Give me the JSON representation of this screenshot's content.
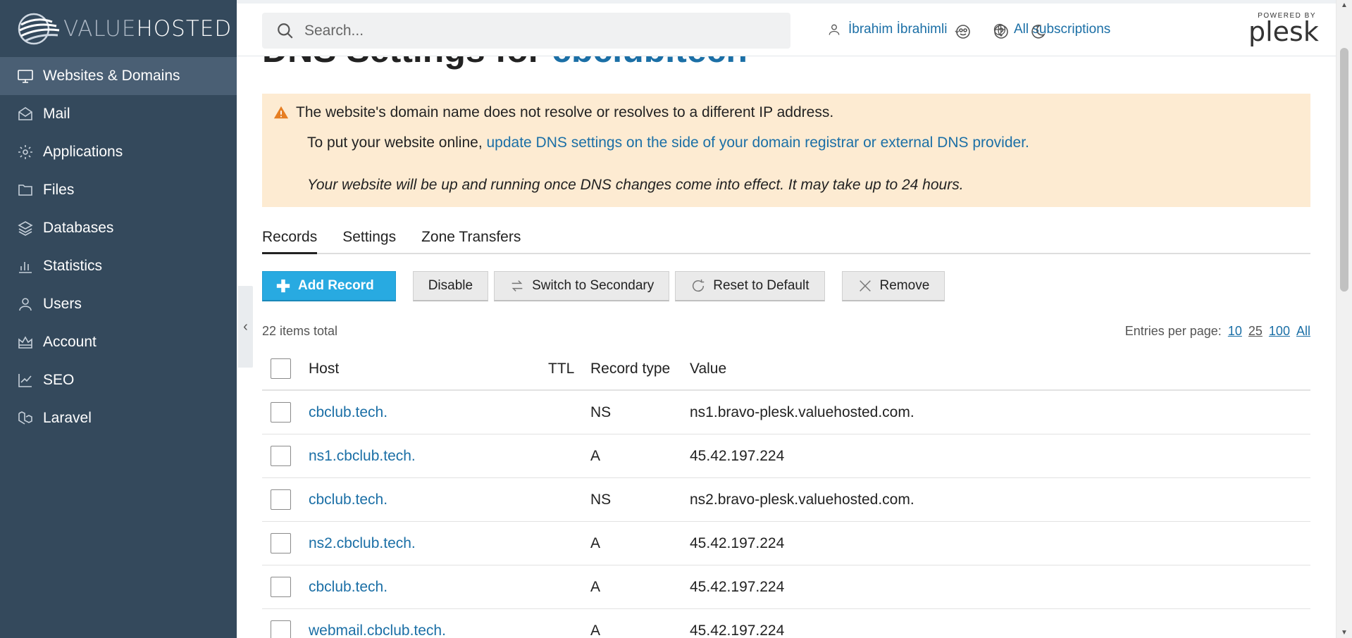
{
  "brand": {
    "logo_left": "VALUE",
    "logo_right": "HOSTED"
  },
  "sidebar": {
    "items": [
      {
        "label": "Websites & Domains",
        "icon": "monitor-icon",
        "active": true
      },
      {
        "label": "Mail",
        "icon": "envelope-icon"
      },
      {
        "label": "Applications",
        "icon": "gear-icon"
      },
      {
        "label": "Files",
        "icon": "folder-icon"
      },
      {
        "label": "Databases",
        "icon": "layers-icon"
      },
      {
        "label": "Statistics",
        "icon": "bar-chart-icon"
      },
      {
        "label": "Users",
        "icon": "user-icon"
      },
      {
        "label": "Account",
        "icon": "crown-icon"
      },
      {
        "label": "SEO",
        "icon": "trend-chart-icon"
      },
      {
        "label": "Laravel",
        "icon": "laravel-icon"
      }
    ]
  },
  "topbar": {
    "search_placeholder": "Search...",
    "user_name": "İbrahim İbrahimli",
    "subscriptions": "All subscriptions",
    "powered_by": "POWERED BY",
    "plesk": "plesk"
  },
  "page": {
    "title_prefix": "DNS Settings for ",
    "domain": "cbclub.tech"
  },
  "alert": {
    "line1": "The website's domain name does not resolve or resolves to a different IP address.",
    "line2_prefix": "To put your website online, ",
    "line2_link": "update DNS settings on the side of your domain registrar or external DNS provider.",
    "line3": "Your website will be up and running once DNS changes come into effect. It may take up to 24 hours."
  },
  "tabs": [
    "Records",
    "Settings",
    "Zone Transfers"
  ],
  "toolbar": {
    "add": "Add Record",
    "disable": "Disable",
    "switch": "Switch to Secondary",
    "reset": "Reset to Default",
    "remove": "Remove"
  },
  "list_meta": {
    "total": "22 items total",
    "entries_label": "Entries per page:",
    "options": [
      "10",
      "25",
      "100",
      "All"
    ]
  },
  "table": {
    "headers": {
      "host": "Host",
      "ttl": "TTL",
      "type": "Record type",
      "value": "Value"
    },
    "rows": [
      {
        "host": "cbclub.tech.",
        "ttl": "",
        "type": "NS",
        "value": "ns1.bravo-plesk.valuehosted.com."
      },
      {
        "host": "ns1.cbclub.tech.",
        "ttl": "",
        "type": "A",
        "value": "45.42.197.224"
      },
      {
        "host": "cbclub.tech.",
        "ttl": "",
        "type": "NS",
        "value": "ns2.bravo-plesk.valuehosted.com."
      },
      {
        "host": "ns2.cbclub.tech.",
        "ttl": "",
        "type": "A",
        "value": "45.42.197.224"
      },
      {
        "host": "cbclub.tech.",
        "ttl": "",
        "type": "A",
        "value": "45.42.197.224"
      },
      {
        "host": "webmail.cbclub.tech.",
        "ttl": "",
        "type": "A",
        "value": "45.42.197.224"
      }
    ]
  },
  "colors": {
    "sidebar": "#34495c",
    "link": "#1b6fa6",
    "primary": "#28aae1",
    "alert_bg": "#fdebd2",
    "warning": "#e67e22"
  }
}
